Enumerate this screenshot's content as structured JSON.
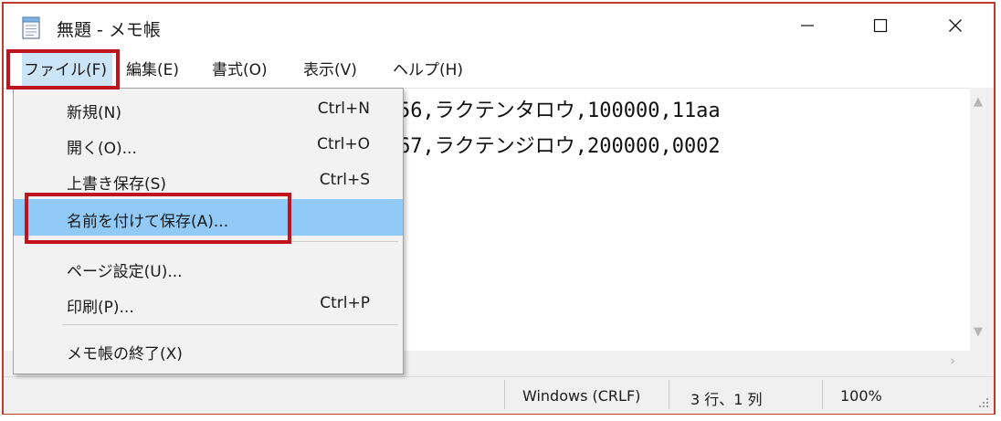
{
  "window": {
    "title": "無題 - メモ帳"
  },
  "menubar": {
    "items": [
      {
        "label": "ファイル(F)"
      },
      {
        "label": "編集(E)"
      },
      {
        "label": "書式(O)"
      },
      {
        "label": "表示(V)"
      },
      {
        "label": "ヘルプ(H)"
      }
    ]
  },
  "editor": {
    "lines": [
      "56,ラクテンタロウ,100000,11aa",
      "67,ラクテンジロウ,200000,0002"
    ]
  },
  "file_menu": {
    "items": [
      {
        "label": "新規(N)",
        "shortcut": "Ctrl+N"
      },
      {
        "label": "開く(O)...",
        "shortcut": "Ctrl+O"
      },
      {
        "label": "上書き保存(S)",
        "shortcut": "Ctrl+S"
      },
      {
        "label": "名前を付けて保存(A)...",
        "shortcut": "",
        "highlighted": true
      },
      {
        "label": "ページ設定(U)...",
        "shortcut": ""
      },
      {
        "label": "印刷(P)...",
        "shortcut": "Ctrl+P"
      },
      {
        "label": "メモ帳の終了(X)",
        "shortcut": ""
      }
    ]
  },
  "statusbar": {
    "encoding": "Windows (CRLF)",
    "position": "3 行、1 列",
    "zoom": "100%"
  },
  "colors": {
    "highlight_box": "#c0131d",
    "menu_hover": "#91c9f7",
    "menu_active": "#cce4f7"
  },
  "icons": {
    "app": "notepad-icon",
    "minimize": "minimize-icon",
    "maximize": "maximize-icon",
    "close": "close-icon"
  }
}
